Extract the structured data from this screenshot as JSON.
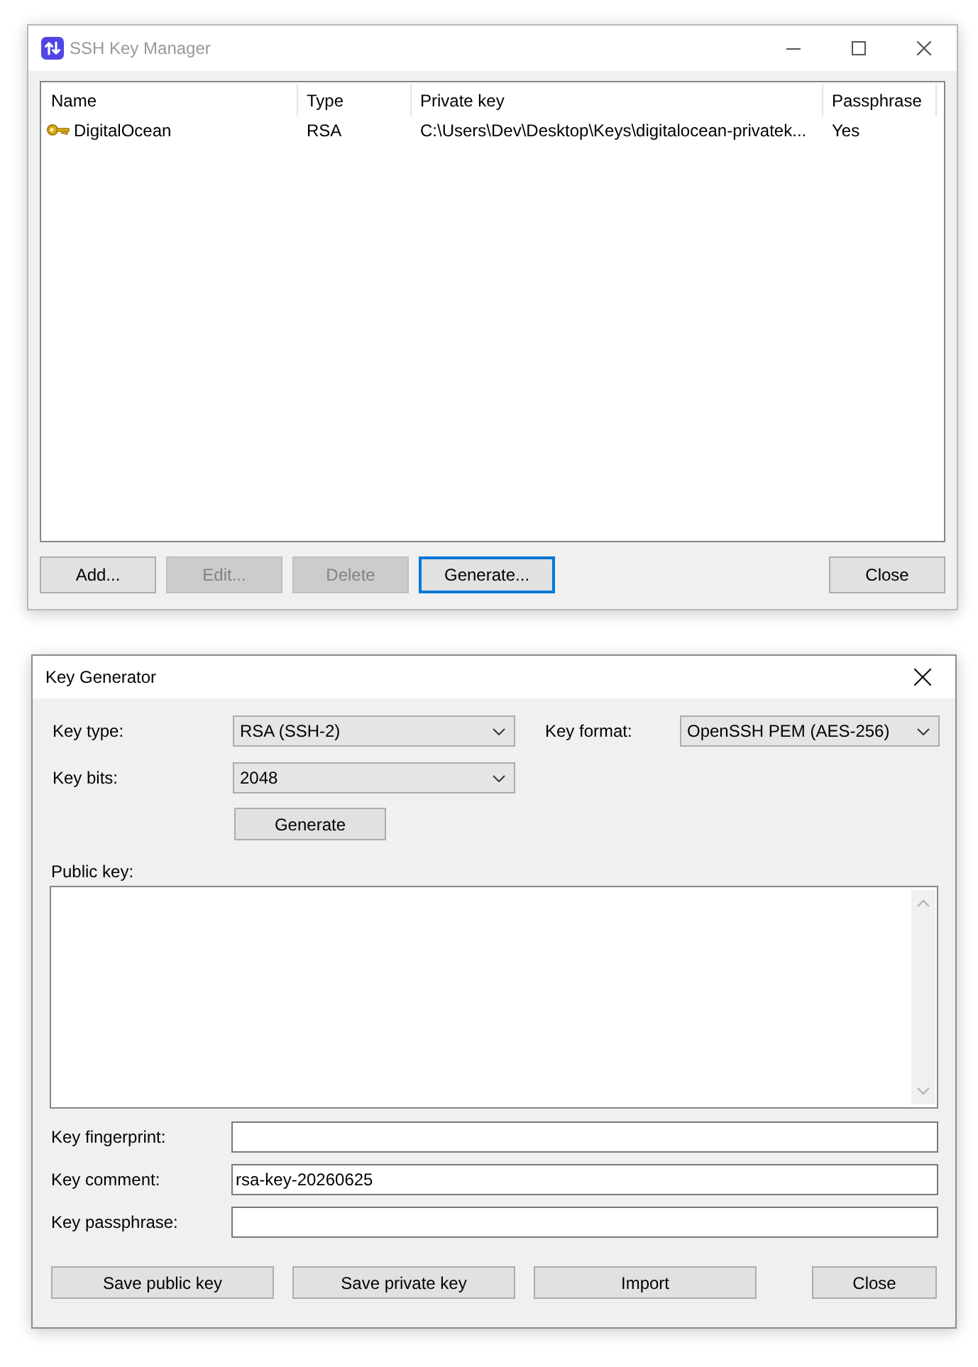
{
  "manager_window": {
    "title": "SSH Key Manager",
    "active": false,
    "table": {
      "columns": [
        "Name",
        "Type",
        "Private key",
        "Passphrase"
      ],
      "rows": [
        {
          "cells": [
            "DigitalOcean",
            "RSA",
            "C:\\Users\\Dev\\Desktop\\Keys\\digitalocean-privatek...",
            "Yes"
          ]
        }
      ]
    },
    "buttons": [
      {
        "label": "Add...",
        "disabled": false,
        "focused": false
      },
      {
        "label": "Edit...",
        "disabled": true,
        "focused": false
      },
      {
        "label": "Delete",
        "disabled": true,
        "focused": false
      },
      {
        "label": "Generate...",
        "disabled": false,
        "focused": true
      },
      {
        "label": "Close",
        "disabled": false,
        "focused": false
      }
    ]
  },
  "generator_window": {
    "title": "Key Generator",
    "active": true,
    "options": [
      {
        "label": "Key type:",
        "value": "RSA (SSH-2)"
      },
      {
        "label": "Key format:",
        "value": "OpenSSH PEM (AES-256)"
      },
      {
        "label": "Key bits:",
        "value": "2048"
      }
    ],
    "generate_button": "Generate",
    "public_key": {
      "label": "Public key:"
    },
    "fields": [
      {
        "label": "Key fingerprint:"
      },
      {
        "label": "Key comment:",
        "value": "rsa-key-20260625"
      },
      {
        "label": "Key passphrase:"
      }
    ],
    "buttons": [
      "Save public key",
      "Save private key",
      "Import",
      "Close"
    ]
  }
}
